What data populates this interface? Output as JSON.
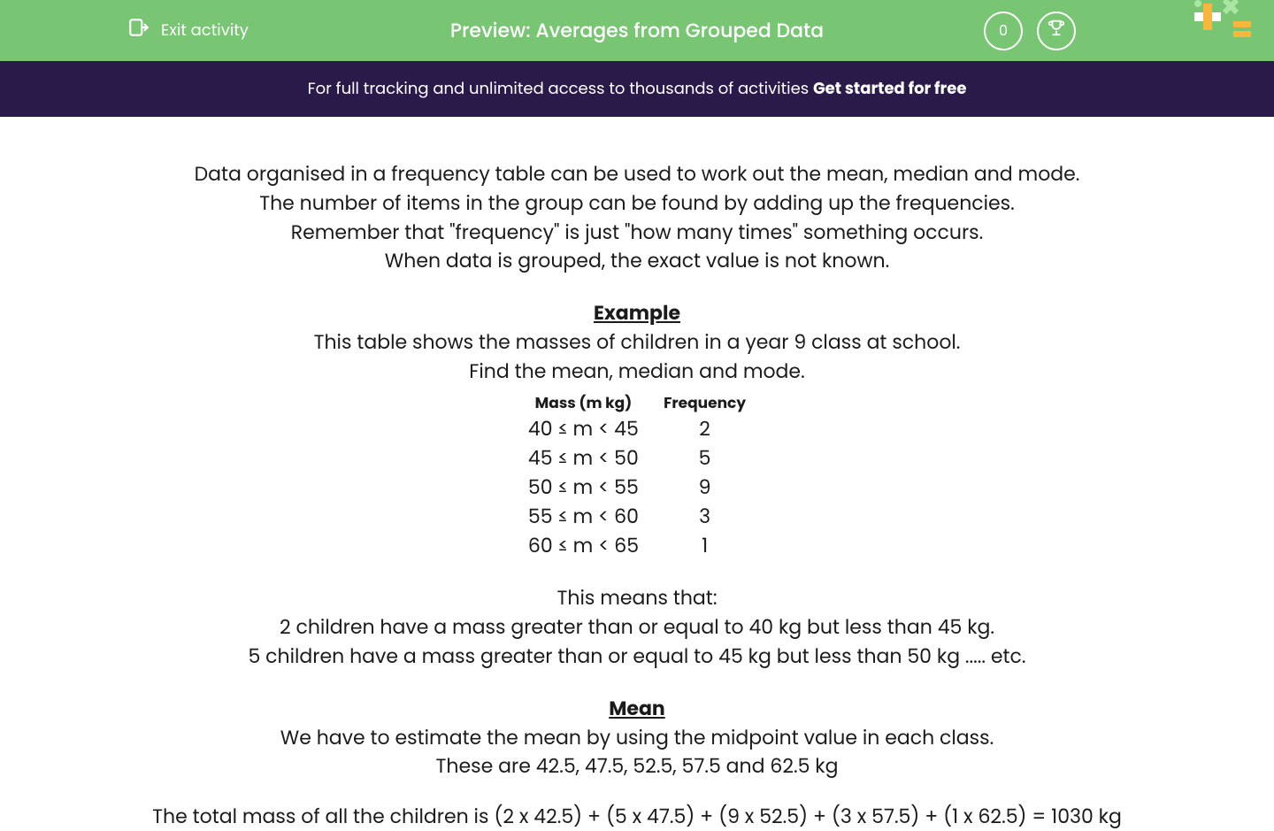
{
  "header": {
    "exit_label": "Exit activity",
    "title": "Preview: Averages from Grouped Data",
    "score": "0"
  },
  "banner": {
    "prefix": "For full tracking and unlimited access to thousands of activities ",
    "cta": "Get started for free"
  },
  "intro": {
    "l1": "Data organised in a frequency table can be used to work out the mean, median and mode.",
    "l2": "The number of items in the group can be found by adding up the frequencies.",
    "l3": "Remember that \"frequency\" is just \"how many times\" something occurs.",
    "l4": "When data is grouped, the exact value is not known."
  },
  "example": {
    "heading": "Example",
    "l1": "This table shows the masses of children in a year 9 class at school.",
    "l2": "Find the mean, median and mode.",
    "table": {
      "h1": "Mass (m kg)",
      "h2": "Frequency",
      "rows": [
        {
          "mass": "40 ≤ m < 45",
          "freq": "2"
        },
        {
          "mass": "45 ≤ m < 50",
          "freq": "5"
        },
        {
          "mass": "50 ≤ m < 55",
          "freq": "9"
        },
        {
          "mass": "55 ≤ m < 60",
          "freq": "3"
        },
        {
          "mass": "60 ≤ m < 65",
          "freq": "1"
        }
      ]
    }
  },
  "explanation": {
    "l1": "This means that:",
    "l2": "2 children have a mass greater than or equal to 40 kg but less than 45 kg.",
    "l3": "5 children have a mass greater than or equal to 45 kg but less than 50 kg ..... etc."
  },
  "mean": {
    "heading": "Mean",
    "l1": "We have to estimate the mean by using the midpoint value in each class.",
    "l2": "These are 42.5, 47.5, 52.5, 57.5 and 62.5 kg",
    "l3": "The total mass of all the children is (2 x 42.5) + (5 x 47.5) + (9 x 52.5) + (3 x 57.5) + (1 x 62.5) = 1030 kg"
  }
}
